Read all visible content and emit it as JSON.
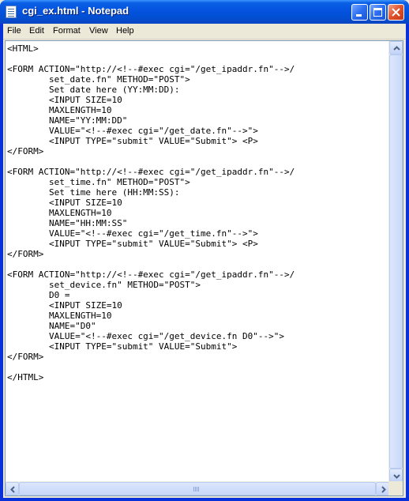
{
  "window": {
    "title": "cgi_ex.html - Notepad"
  },
  "menubar": {
    "items": [
      "File",
      "Edit",
      "Format",
      "View",
      "Help"
    ]
  },
  "document": {
    "lines": [
      "<HTML>",
      "",
      "<FORM ACTION=\"http://<!--#exec cgi=\"/get_ipaddr.fn\"-->/",
      "        set_date.fn\" METHOD=\"POST\">",
      "        Set date here (YY:MM:DD):",
      "        <INPUT SIZE=10",
      "        MAXLENGTH=10",
      "        NAME=\"YY:MM:DD\"",
      "        VALUE=\"<!--#exec cgi=\"/get_date.fn\"-->\">",
      "        <INPUT TYPE=\"submit\" VALUE=\"Submit\"> <P>",
      "</FORM>",
      "",
      "<FORM ACTION=\"http://<!--#exec cgi=\"/get_ipaddr.fn\"-->/",
      "        set_time.fn\" METHOD=\"POST\">",
      "        Set time here (HH:MM:SS):",
      "        <INPUT SIZE=10",
      "        MAXLENGTH=10",
      "        NAME=\"HH:MM:SS\"",
      "        VALUE=\"<!--#exec cgi=\"/get_time.fn\"-->\">",
      "        <INPUT TYPE=\"submit\" VALUE=\"Submit\"> <P>",
      "</FORM>",
      "",
      "<FORM ACTION=\"http://<!--#exec cgi=\"/get_ipaddr.fn\"-->/",
      "        set_device.fn\" METHOD=\"POST\">",
      "        D0 =",
      "        <INPUT SIZE=10",
      "        MAXLENGTH=10",
      "        NAME=\"D0\"",
      "        VALUE=\"<!--#exec cgi=\"/get_device.fn D0\"-->\">",
      "        <INPUT TYPE=\"submit\" VALUE=\"Submit\">",
      "</FORM>",
      "",
      "</HTML>"
    ]
  },
  "icons": {
    "app": "notepad-icon",
    "minimize": "minimize-icon",
    "maximize": "maximize-icon",
    "close": "close-icon"
  },
  "colors": {
    "titlebar": "#0553df",
    "editor_bg": "#ffffff",
    "chrome": "#ece9d8"
  }
}
